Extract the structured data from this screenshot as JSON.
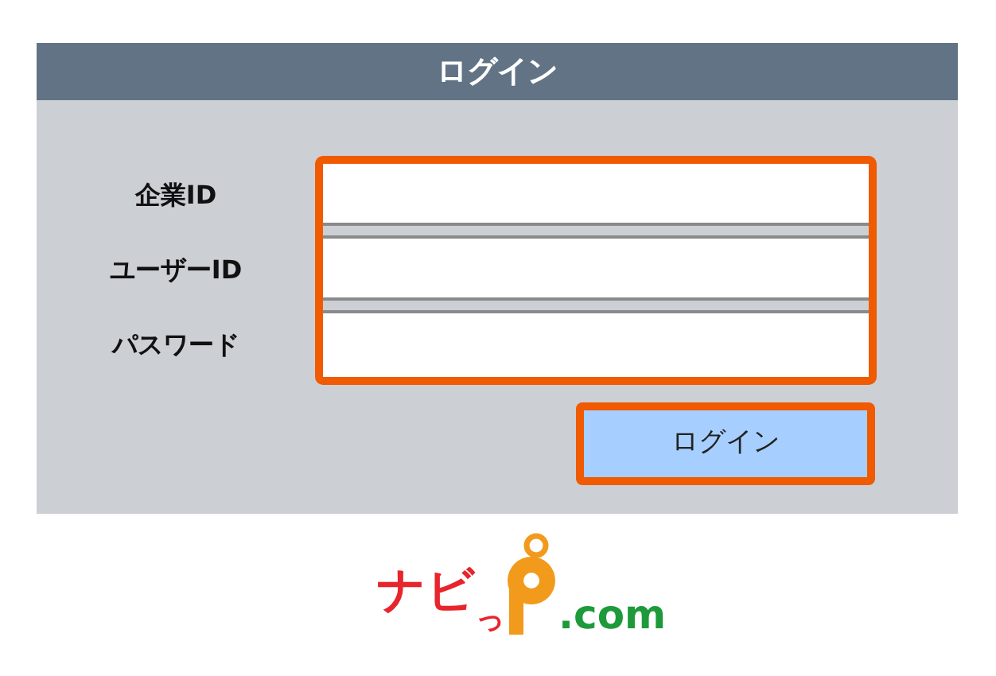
{
  "title": "ログイン",
  "fields": [
    {
      "label": "企業ID"
    },
    {
      "label": "ユーザーID"
    },
    {
      "label": "パスワード"
    }
  ],
  "button": "ログイン",
  "logo": {
    "main_text": "ナビ",
    "small_text": "っ",
    "domain_text": ".com"
  }
}
